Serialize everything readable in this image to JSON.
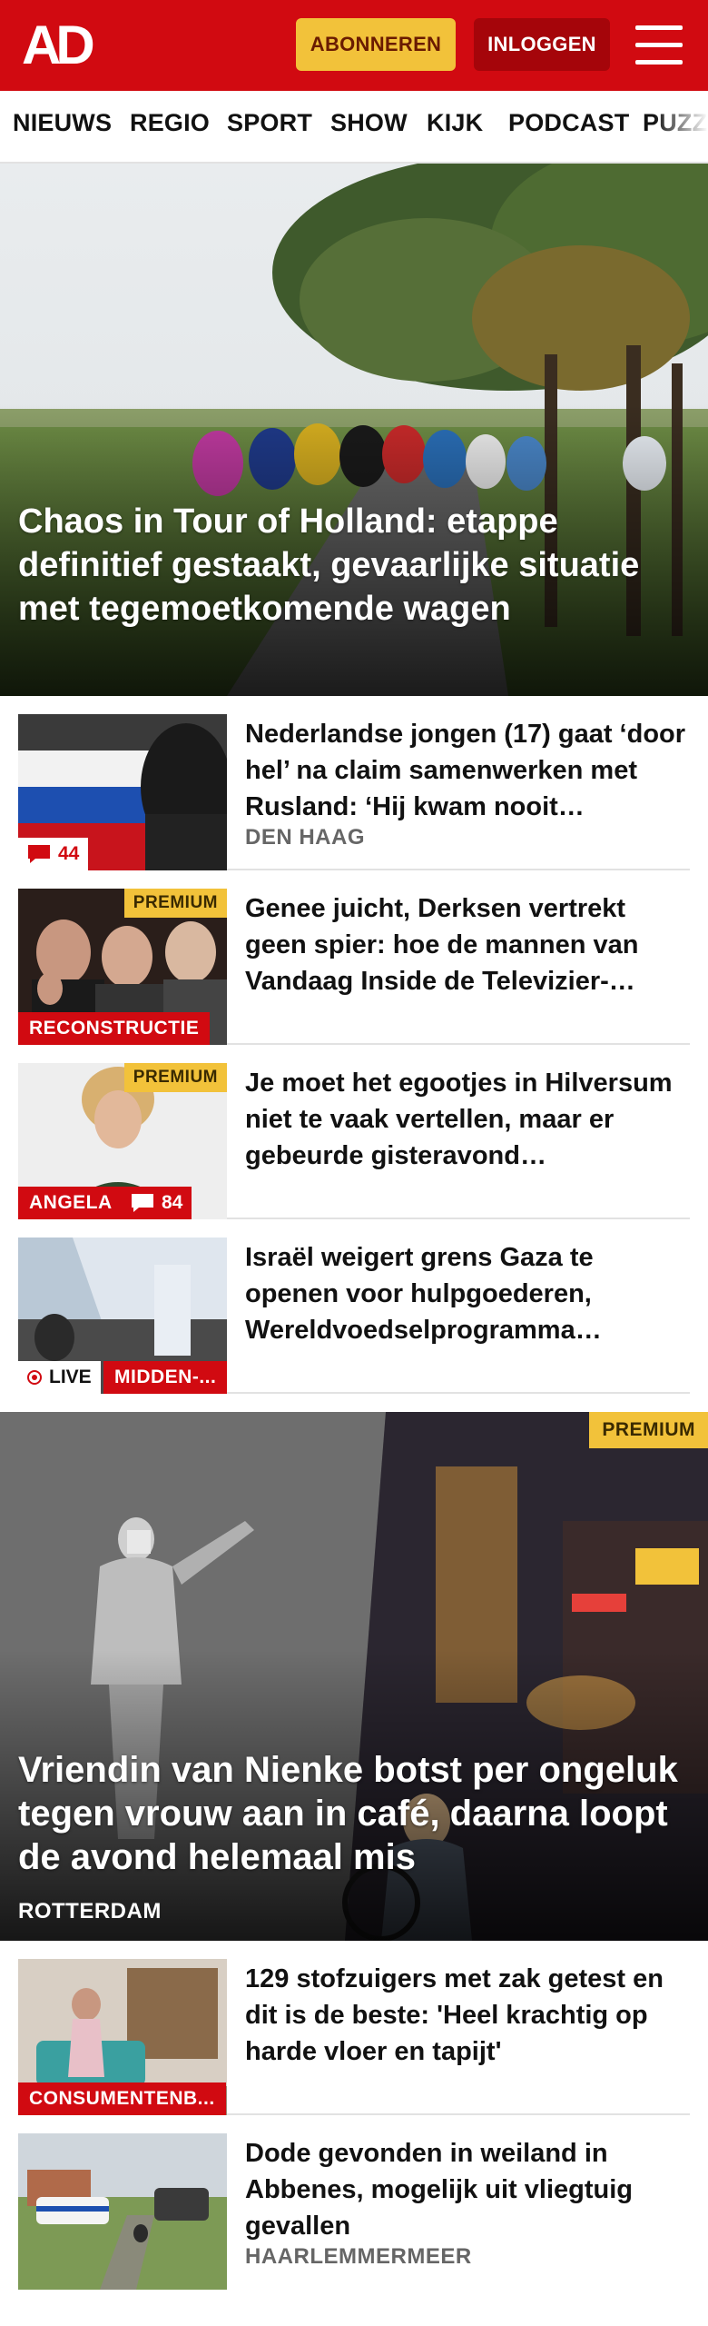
{
  "header": {
    "logo": "AD",
    "subscribe_label": "ABONNEREN",
    "login_label": "INLOGGEN",
    "brand_color": "#d10a11"
  },
  "nav": {
    "items": [
      "NIEUWS",
      "REGIO",
      "SPORT",
      "SHOW",
      "KIJK",
      "PODCAST",
      "PUZZ"
    ]
  },
  "hero": {
    "title": "Chaos in Tour of Holland: etappe definitief gestaakt, gevaarlijke situatie met tegemoetkomende wagen"
  },
  "articles": [
    {
      "title": "Nederlandse jongen (17) gaat ‘door hel’ na claim samenwerken met Rusland: ‘Hij kwam nooit…",
      "location": "DEN HAAG",
      "comments": "44"
    },
    {
      "title": "Genee juicht, Derksen vertrekt geen spier: hoe de mannen van Vandaag Inside de Televizier-…",
      "premium": "PREMIUM",
      "tag": "RECONSTRUCTIE"
    },
    {
      "title": "Je moet het egootjes in Hilversum niet te vaak vertellen, maar er gebeurde gisteravond…",
      "premium": "PREMIUM",
      "tag": "ANGELA",
      "comments": "84"
    },
    {
      "title": "Israël weigert grens Gaza te openen voor hulpgoederen, Wereldvoedselprogramma…",
      "live": "LIVE",
      "tag": "MIDDEN-..."
    }
  ],
  "feature": {
    "premium": "PREMIUM",
    "title": "Vriendin van Nienke botst per ongeluk tegen vrouw aan in café, daarna loopt de avond helemaal mis",
    "location": "ROTTERDAM"
  },
  "articles2": [
    {
      "title": "129 stofzuigers met zak getest en dit is de beste: 'Heel krachtig op harde vloer en tapijt'",
      "tag": "CONSUMENTENB..."
    },
    {
      "title": "Dode gevonden in weiland in Abbenes, mogelijk uit vliegtuig gevallen",
      "location": "HAARLEMMERMEER"
    }
  ]
}
